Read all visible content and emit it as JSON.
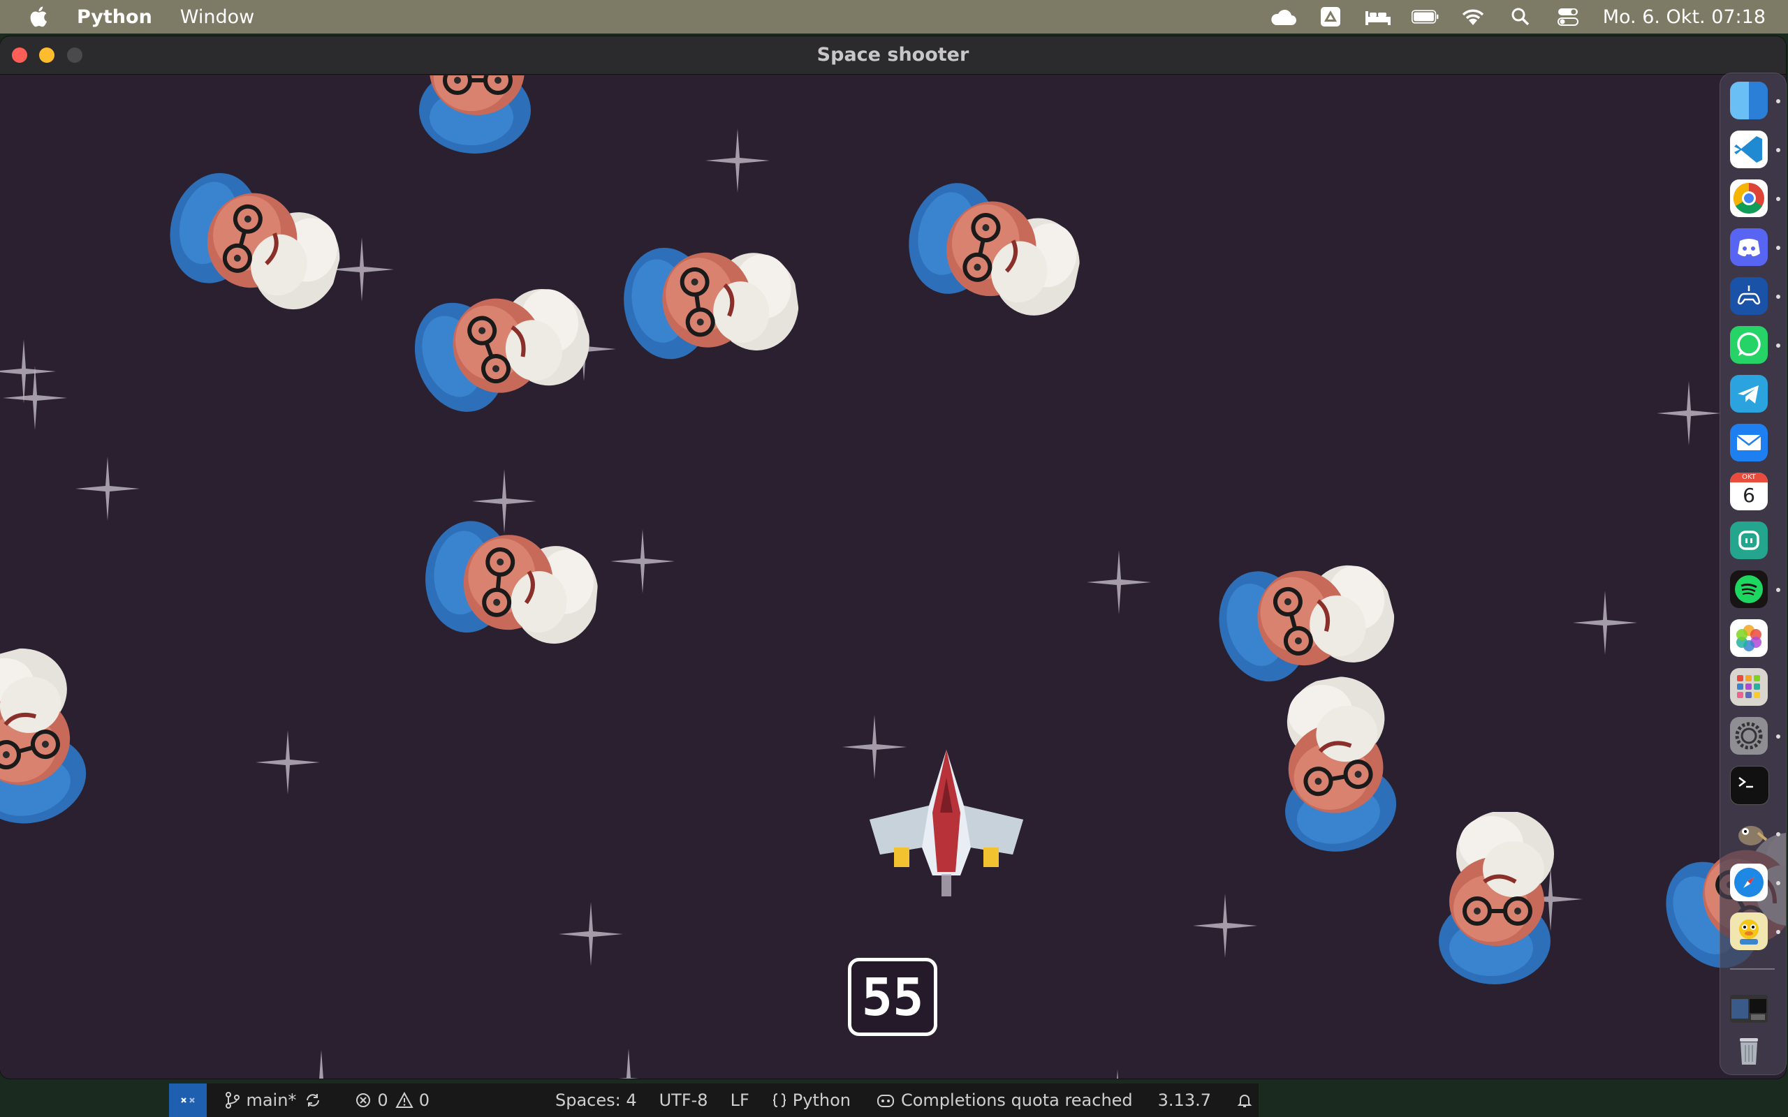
{
  "menubar": {
    "app_name": "Python",
    "menus": [
      "Window"
    ],
    "clock": "Mo. 6. Okt. 07:18",
    "status_icons": [
      "cloud-icon",
      "google-drive-icon",
      "bed-icon",
      "battery-icon",
      "wifi-icon",
      "search-icon",
      "control-center-icon"
    ]
  },
  "window": {
    "title": "Space shooter"
  },
  "game": {
    "score": "55",
    "background_color": "#2a2030",
    "enemy_sprite": "face-with-glasses-and-blue-cap",
    "player_sprite": "spaceship-icon"
  },
  "dock": {
    "apps": [
      "finder-icon",
      "vscode-icon",
      "chrome-icon",
      "discord-icon",
      "playstation-remote-icon",
      "whatsapp-icon",
      "telegram-icon",
      "mail-icon",
      "calendar-icon",
      "chatgpt-icon",
      "spotify-icon",
      "photos-icon",
      "launchpad-icon",
      "system-settings-icon",
      "terminal-icon",
      "gimp-icon",
      "safari-icon",
      "cyberduck-icon",
      "recent-window-thumbnail",
      "trash-icon"
    ],
    "calendar_month": "OKT",
    "calendar_day": "6"
  },
  "statusbar": {
    "branch": "main*",
    "errors": "0",
    "warnings": "0",
    "spaces": "Spaces: 4",
    "encoding": "UTF-8",
    "eol": "LF",
    "language": "Python",
    "copilot": "Completions quota reached",
    "version": "3.13.7"
  }
}
